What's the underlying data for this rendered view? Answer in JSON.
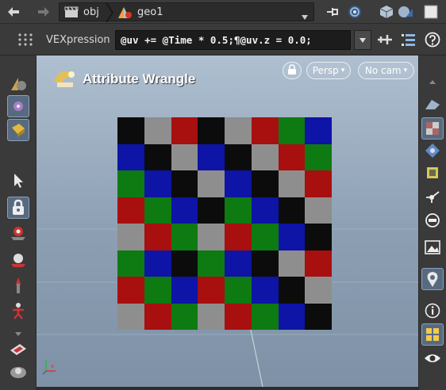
{
  "pathbar": {
    "context": "obj",
    "node": "geo1"
  },
  "expression": {
    "label": "VEXpression",
    "value": "@uv += @Time * 0.5;¶@uv.z = 0.0;"
  },
  "viewport": {
    "title": "Attribute Wrangle",
    "view_mode": "Persp",
    "camera": "No cam"
  },
  "checker": {
    "colors": {
      "K": "#0c0c0c",
      "G": "#8e8e8e",
      "R": "#a80f0f",
      "B": "#0d14a6",
      "N": "#0e7a12"
    },
    "rows": [
      [
        "K",
        "G",
        "R",
        "K",
        "G",
        "R",
        "N",
        "B"
      ],
      [
        "B",
        "K",
        "G",
        "B",
        "K",
        "G",
        "R",
        "N"
      ],
      [
        "N",
        "B",
        "K",
        "G",
        "B",
        "K",
        "G",
        "R"
      ],
      [
        "R",
        "N",
        "B",
        "K",
        "N",
        "B",
        "K",
        "G"
      ],
      [
        "G",
        "R",
        "N",
        "G",
        "R",
        "N",
        "B",
        "K"
      ],
      [
        "N",
        "B",
        "K",
        "N",
        "B",
        "K",
        "G",
        "R"
      ],
      [
        "R",
        "N",
        "B",
        "R",
        "N",
        "B",
        "K",
        "G"
      ],
      [
        "G",
        "R",
        "N",
        "G",
        "R",
        "N",
        "B",
        "K"
      ]
    ]
  },
  "colors": {
    "accent_selected": "#586a80",
    "viewport_top": "#aebfd0",
    "viewport_bottom": "#7e91a6"
  }
}
